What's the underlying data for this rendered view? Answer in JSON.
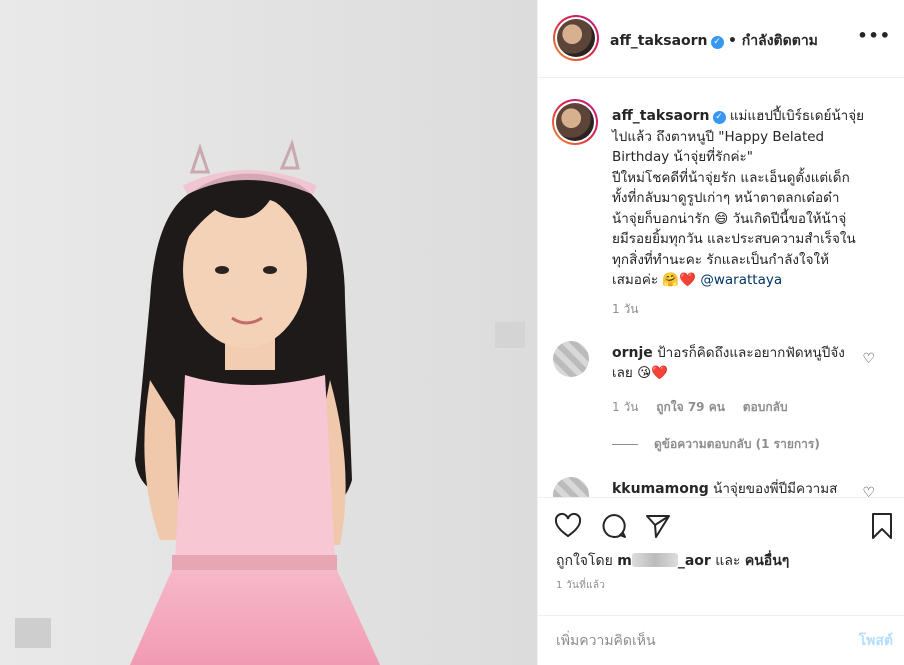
{
  "post": {
    "username": "aff_taksaorn",
    "follow_status": "• กำลังติดตาม",
    "more": "•••",
    "caption_lines": [
      "แม่แฮปปี้เบิร์ธเดย์น้าจุ่ย",
      "ไปแล้ว ถึงตาหนูปี \"Happy Belated",
      "Birthday น้าจุ่ยที่รักค่ะ\"",
      "ปีใหม่โชคดีที่น้าจุ่ยรัก และเอ็นดูตั้งแต่เด็ก",
      "ทั้งที่กลับมาดูรูปเก่าๆ หน้าตาตลกเด๋อด๋า",
      "น้าจุ่ยก็บอกน่ารัก 😄 วันเกิดปีนี้ขอให้น้าจุ่",
      "ยมีรอยยิ้มทุกวัน และประสบความสำเร็จใน",
      "ทุกสิ่งที่ทำนะคะ รักและเป็นกำลังใจให้",
      "เสมอค่ะ 🤗❤️"
    ],
    "mention": "@warattaya",
    "posted_ago": "1 วัน"
  },
  "comments": [
    {
      "username": "ornje",
      "text": "ป้าอรก็คิดถึงและอยากฟัดหนูปีจังเลย 😘❤️",
      "ago": "1 วัน",
      "likes": "ถูกใจ 79 คน",
      "reply": "ตอบกลับ",
      "view_replies": "ดูข้อความตอบกลับ (1 รายการ)"
    },
    {
      "username": "kkumamong",
      "text": "น้าจุ่ยของพี่ปีมีความส"
    }
  ],
  "likes": {
    "prefix": "ถูกใจโดย",
    "name_start": "m",
    "name_end": "_aor",
    "joiner": "และ",
    "others": "คนอื่นๆ"
  },
  "time_label": "1 วันที่แล้ว",
  "comment_box": {
    "placeholder": "เพิ่มความคิดเห็น",
    "post_label": "โพสต์"
  },
  "colors": {
    "verified": "#3897f0",
    "post_disabled": "#b2dffc",
    "mention": "#003569",
    "secondary_text": "#8e8e8e"
  }
}
